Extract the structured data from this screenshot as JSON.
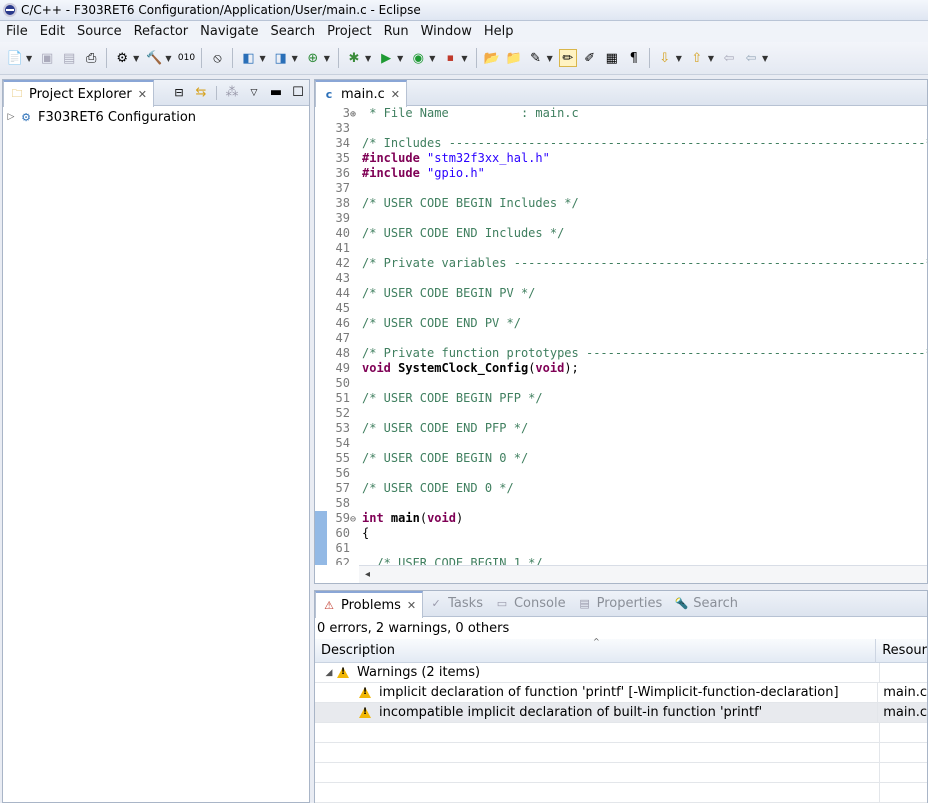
{
  "window": {
    "title": "C/C++ - F303RET6 Configuration/Application/User/main.c - Eclipse"
  },
  "menu": [
    "File",
    "Edit",
    "Source",
    "Refactor",
    "Navigate",
    "Search",
    "Project",
    "Run",
    "Window",
    "Help"
  ],
  "project_explorer": {
    "tab_label": "Project Explorer",
    "tree": [
      {
        "label": "F303RET6 Configuration"
      }
    ]
  },
  "editor": {
    "tab_label": "main.c",
    "lines": [
      {
        "n": "3",
        "text": " * File Name          : main.c",
        "cls": "cm",
        "fold": "+"
      },
      {
        "n": "33",
        "text": ""
      },
      {
        "n": "34",
        "text": "/* Includes ------------------------------------------------------------------*/",
        "cls": "cm"
      },
      {
        "n": "35",
        "kw": "#include",
        "str": "\"stm32f3xx_hal.h\""
      },
      {
        "n": "36",
        "kw": "#include",
        "str": "\"gpio.h\""
      },
      {
        "n": "37",
        "text": ""
      },
      {
        "n": "38",
        "text": "/* USER CODE BEGIN Includes */",
        "cls": "cm"
      },
      {
        "n": "39",
        "text": ""
      },
      {
        "n": "40",
        "text": "/* USER CODE END Includes */",
        "cls": "cm"
      },
      {
        "n": "41",
        "text": ""
      },
      {
        "n": "42",
        "text": "/* Private variables ---------------------------------------------------------*/",
        "cls": "cm"
      },
      {
        "n": "43",
        "text": ""
      },
      {
        "n": "44",
        "text": "/* USER CODE BEGIN PV */",
        "cls": "cm"
      },
      {
        "n": "45",
        "text": ""
      },
      {
        "n": "46",
        "text": "/* USER CODE END PV */",
        "cls": "cm"
      },
      {
        "n": "47",
        "text": ""
      },
      {
        "n": "48",
        "text": "/* Private function prototypes -----------------------------------------------*/",
        "cls": "cm"
      },
      {
        "n": "49",
        "kw": "void",
        "fn": "SystemClock_Config",
        "rest": "(",
        "kw2": "void",
        "rest2": ");"
      },
      {
        "n": "50",
        "text": ""
      },
      {
        "n": "51",
        "text": "/* USER CODE BEGIN PFP */",
        "cls": "cm"
      },
      {
        "n": "52",
        "text": ""
      },
      {
        "n": "53",
        "text": "/* USER CODE END PFP */",
        "cls": "cm"
      },
      {
        "n": "54",
        "text": ""
      },
      {
        "n": "55",
        "text": "/* USER CODE BEGIN 0 */",
        "cls": "cm"
      },
      {
        "n": "56",
        "text": ""
      },
      {
        "n": "57",
        "text": "/* USER CODE END 0 */",
        "cls": "cm"
      },
      {
        "n": "58",
        "text": ""
      },
      {
        "n": "59",
        "kw": "int",
        "fn": "main",
        "rest": "(",
        "kw2": "void",
        "rest2": ")",
        "fold": "-",
        "mark": true
      },
      {
        "n": "60",
        "text": "{",
        "mark": true
      },
      {
        "n": "61",
        "text": "",
        "mark": true
      },
      {
        "n": "62",
        "text": "  /* USER CODE BEGIN 1 */",
        "cls": "cm",
        "mark": true
      }
    ]
  },
  "bottom_tabs": [
    {
      "label": "Problems",
      "active": true
    },
    {
      "label": "Tasks",
      "active": false
    },
    {
      "label": "Console",
      "active": false
    },
    {
      "label": "Properties",
      "active": false
    },
    {
      "label": "Search",
      "active": false
    }
  ],
  "problems": {
    "summary": "0 errors, 2 warnings, 0 others",
    "col_description": "Description",
    "col_resource": "Resour",
    "group_label": "Warnings (2 items)",
    "rows": [
      {
        "description": "implicit declaration of function 'printf' [-Wimplicit-function-declaration]",
        "resource": "main.c"
      },
      {
        "description": "incompatible implicit declaration of built-in function 'printf'",
        "resource": "main.c"
      }
    ]
  }
}
